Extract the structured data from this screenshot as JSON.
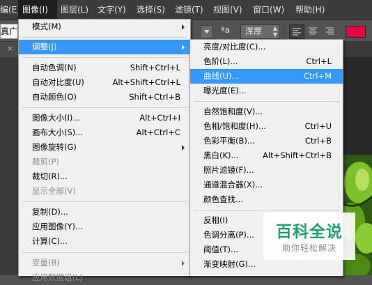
{
  "menubar": {
    "items": [
      "编(E)",
      "图像(I)",
      "图层(L)",
      "文字(Y)",
      "选择(S)",
      "滤镜(T)",
      "视图(V)",
      "窗口(W)",
      "帮助(H)"
    ]
  },
  "options": {
    "font_name_partial": "真广",
    "aa_icon": "ªa",
    "aa_value": "浑厚",
    "color": "#e8003a"
  },
  "image_menu": [
    {
      "label": "模式(M)",
      "sub": true
    },
    {
      "label": "调整(J)",
      "sub": true,
      "highlight": true
    },
    {
      "label": "自动色调(N)",
      "shortcut": "Shift+Ctrl+L"
    },
    {
      "label": "自动对比度(U)",
      "shortcut": "Alt+Shift+Ctrl+L"
    },
    {
      "label": "自动颜色(O)",
      "shortcut": "Shift+Ctrl+B"
    },
    {
      "label": "图像大小(I)...",
      "shortcut": "Alt+Ctrl+I"
    },
    {
      "label": "画布大小(S)...",
      "shortcut": "Alt+Ctrl+C"
    },
    {
      "label": "图像旋转(G)",
      "sub": true
    },
    {
      "label": "裁剪(P)",
      "disabled": true
    },
    {
      "label": "裁切(R)..."
    },
    {
      "label": "显示全部(V)",
      "disabled": true
    },
    {
      "label": "复制(D)..."
    },
    {
      "label": "应用图像(Y)..."
    },
    {
      "label": "计算(C)..."
    },
    {
      "label": "变量(B)",
      "sub": true,
      "disabled": true
    },
    {
      "label": "应用数据组(L)",
      "disabled": true
    }
  ],
  "adjust_menu": [
    {
      "label": "亮度/对比度(C)..."
    },
    {
      "label": "色阶(L)...",
      "shortcut": "Ctrl+L"
    },
    {
      "label": "曲线(U)...",
      "shortcut": "Ctrl+M",
      "highlight": true
    },
    {
      "label": "曝光度(E)..."
    },
    {
      "label": "自然饱和度(V)..."
    },
    {
      "label": "色相/饱和度(H)...",
      "shortcut": "Ctrl+U"
    },
    {
      "label": "色彩平衡(B)...",
      "shortcut": "Ctrl+B"
    },
    {
      "label": "黑白(K)...",
      "shortcut": "Alt+Shift+Ctrl+B"
    },
    {
      "label": "照片滤镜(F)..."
    },
    {
      "label": "通道混合器(X)..."
    },
    {
      "label": "颜色查找..."
    },
    {
      "label": "反相(I)"
    },
    {
      "label": "色调分离(P)..."
    },
    {
      "label": "阈值(T)..."
    },
    {
      "label": "渐变映射(G)..."
    }
  ],
  "watermark": {
    "title": "百科全说",
    "subtitle": "助你轻松解决"
  }
}
